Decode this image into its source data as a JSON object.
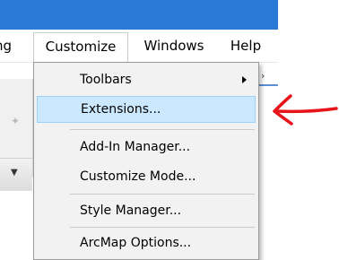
{
  "menu_bar": {
    "partial_left": "ng",
    "customize": "Customize",
    "windows": "Windows",
    "help": "Help"
  },
  "dropdown": {
    "items": [
      {
        "label": "Toolbars",
        "has_submenu": true
      },
      {
        "label": "Extensions...",
        "highlighted": true
      },
      {
        "label": "Add-In Manager..."
      },
      {
        "label": "Customize Mode..."
      },
      {
        "label": "Style Manager..."
      },
      {
        "label": "ArcMap Options..."
      }
    ]
  },
  "colors": {
    "title_bar": "#2b79d7",
    "highlight_bg": "#cce8ff",
    "highlight_border": "#99d1ff",
    "annotation_arrow": "#e8141b"
  },
  "icons": {
    "submenu_arrow": "chevron-right-icon",
    "annotation": "red-arrow-icon"
  }
}
